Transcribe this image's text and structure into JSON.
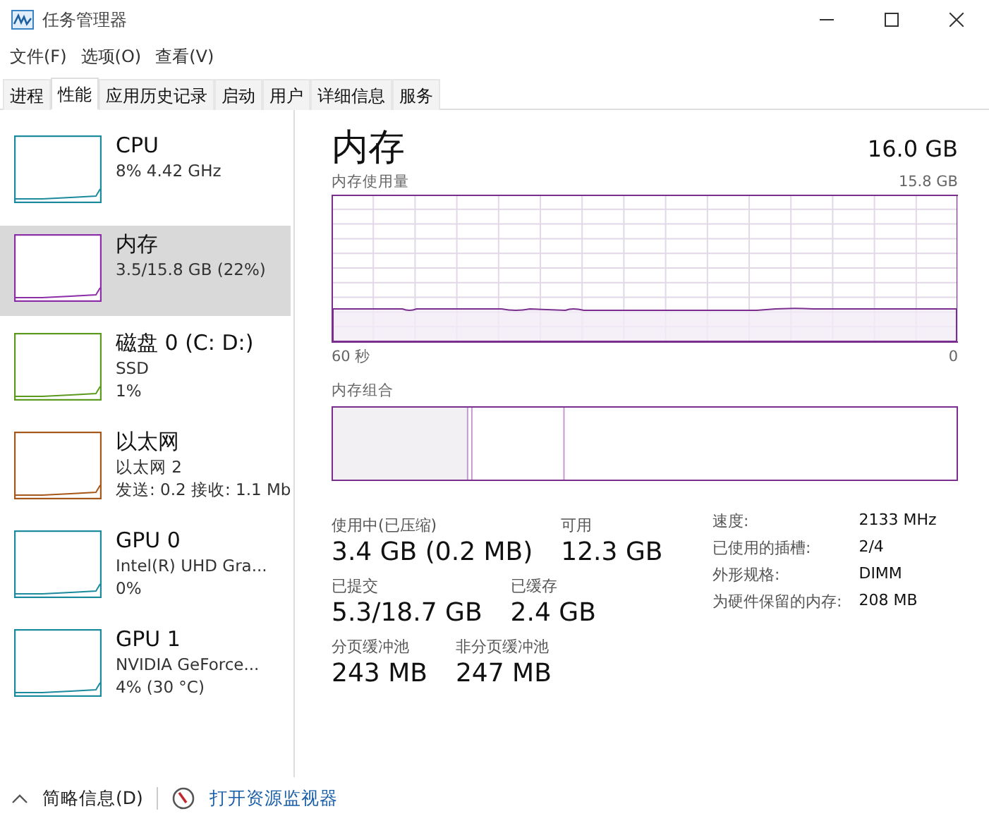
{
  "window": {
    "title": "任务管理器"
  },
  "menu": [
    "文件(F)",
    "选项(O)",
    "查看(V)"
  ],
  "tabs": [
    {
      "label": "进程",
      "selected": false
    },
    {
      "label": "性能",
      "selected": true
    },
    {
      "label": "应用历史记录",
      "selected": false
    },
    {
      "label": "启动",
      "selected": false
    },
    {
      "label": "用户",
      "selected": false
    },
    {
      "label": "详细信息",
      "selected": false
    },
    {
      "label": "服务",
      "selected": false
    }
  ],
  "sidebar": {
    "items": [
      {
        "name": "CPU",
        "lines": [
          "8% 4.42 GHz"
        ],
        "color": "#1b8a9c",
        "selected": false
      },
      {
        "name": "内存",
        "lines": [
          "3.5/15.8 GB (22%)"
        ],
        "color": "#8b2ea8",
        "selected": true
      },
      {
        "name": "磁盘 0 (C: D:)",
        "lines": [
          "SSD",
          "1%"
        ],
        "color": "#5c9a1f",
        "selected": false
      },
      {
        "name": "以太网",
        "lines": [
          "以太网 2",
          "发送: 0.2 接收: 1.1 Mb"
        ],
        "color": "#a6571a",
        "selected": false
      },
      {
        "name": "GPU 0",
        "lines": [
          "Intel(R) UHD Gra...",
          "0%"
        ],
        "color": "#1b8a9c",
        "selected": false
      },
      {
        "name": "GPU 1",
        "lines": [
          "NVIDIA GeForce...",
          "4% (30 °C)"
        ],
        "color": "#1b8a9c",
        "selected": false
      }
    ]
  },
  "detail": {
    "title": "内存",
    "total": "16.0 GB",
    "usage_label": "内存使用量",
    "usage_max": "15.8 GB",
    "time_start": "60 秒",
    "time_end": "0",
    "composition_label": "内存组合",
    "stats": [
      [
        {
          "label": "使用中(已压缩)",
          "value": "3.4 GB (0.2 MB)"
        },
        {
          "label": "可用",
          "value": "12.3 GB"
        }
      ],
      [
        {
          "label": "已提交",
          "value": "5.3/18.7 GB"
        },
        {
          "label": "已缓存",
          "value": "2.4 GB"
        }
      ],
      [
        {
          "label": "分页缓冲池",
          "value": "243 MB"
        },
        {
          "label": "非分页缓冲池",
          "value": "247 MB"
        }
      ]
    ],
    "specs": [
      {
        "label": "速度:",
        "value": "2133 MHz"
      },
      {
        "label": "已使用的插槽:",
        "value": "2/4"
      },
      {
        "label": "外形规格:",
        "value": "DIMM"
      },
      {
        "label": "为硬件保留的内存:",
        "value": "208 MB"
      }
    ]
  },
  "footer": {
    "summary": "简略信息(D)",
    "monitor": "打开资源监视器"
  }
}
